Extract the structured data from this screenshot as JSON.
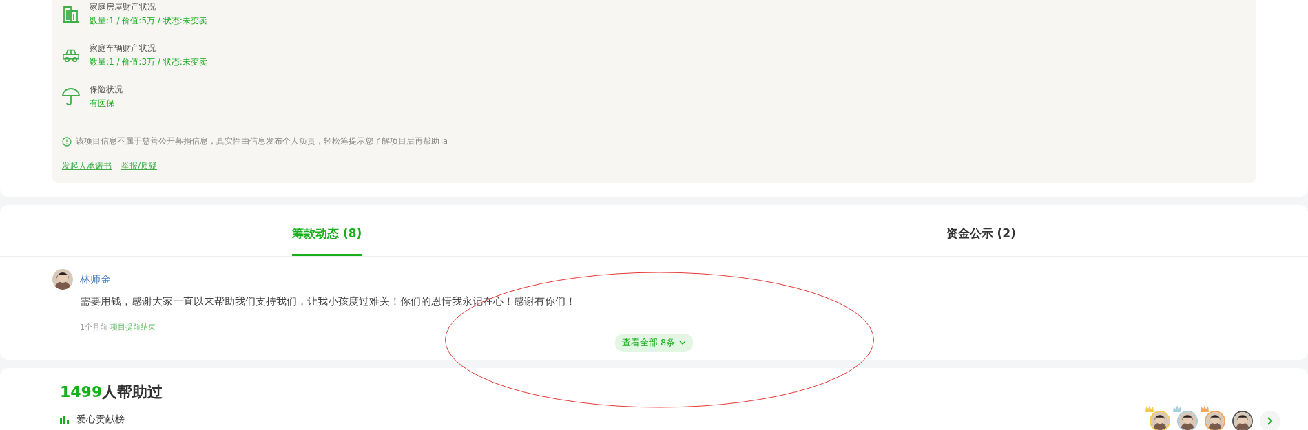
{
  "assets": [
    {
      "kind": "house",
      "label": "家庭房屋财产状况",
      "value": "数量:1 / 价值:5万 / 状态:未变卖"
    },
    {
      "kind": "car",
      "label": "家庭车辆财产状况",
      "value": "数量:1 / 价值:3万 / 状态:未变卖"
    },
    {
      "kind": "umbrella",
      "label": "保险状况",
      "value": "有医保"
    }
  ],
  "notice": "该项目信息不属于慈善公开募捐信息，真实性由信息发布个人负责，轻松筹提示您了解项目后再帮助Ta",
  "links": [
    "发起人承诺书",
    "举报/质疑"
  ],
  "tabs": [
    {
      "label": "筹款动态 (8)",
      "selected": true
    },
    {
      "label": "资金公示 (2)",
      "selected": false
    }
  ],
  "posts": [
    {
      "author": "林师金",
      "text": "需要用钱，感谢大家一直以来帮助我们支持我们，让我小孩度过难关！你们的恩情我永记在心！感谢有你们！",
      "time": "1个月前",
      "tag": "项目提前结束"
    }
  ],
  "view_all": "查看全部 8条",
  "helpers": {
    "count": "1499",
    "suffix": "人帮助过",
    "board_title": "爱心贡献榜",
    "avatars": [
      {
        "color": "#f2c94c",
        "crown": true
      },
      {
        "color": "#a9cfd8",
        "crown": true
      },
      {
        "color": "#f2a65a",
        "crown": true
      },
      {
        "color": "#555555",
        "crown": false
      }
    ]
  }
}
